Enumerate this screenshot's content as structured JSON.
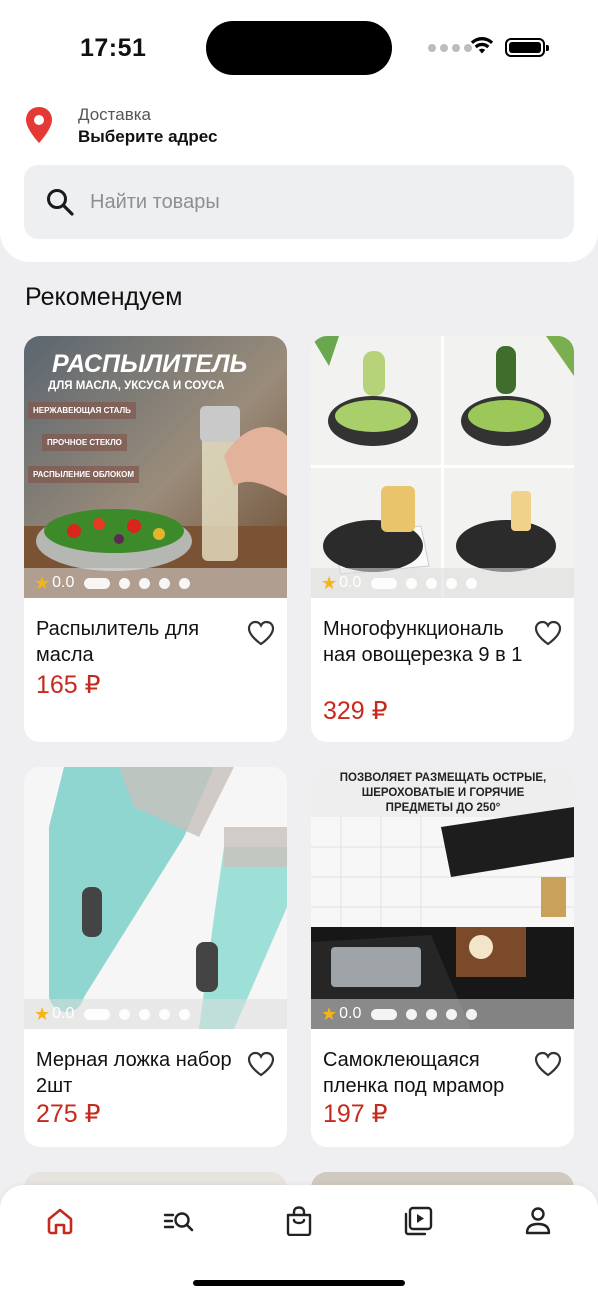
{
  "status_bar": {
    "time": "17:51"
  },
  "header": {
    "delivery_label": "Доставка",
    "delivery_address": "Выберите адрес",
    "search_placeholder": "Найти товары"
  },
  "section": {
    "title": "Рекомендуем"
  },
  "products": [
    {
      "title": "Распылитель для масла",
      "price": "165 ₽",
      "rating": "0.0",
      "image_text": {
        "headline": "РАСПЫЛИТЕЛЬ",
        "subline": "ДЛЯ МАСЛА, УКСУСА И СОУСА",
        "features": [
          "НЕРЖАВЕЮЩАЯ СТАЛЬ",
          "ПРОЧНОЕ СТЕКЛО",
          "РАСПЫЛЕНИЕ ОБЛОКОМ"
        ]
      }
    },
    {
      "title": "Многофункциональ ная овощерезка 9 в 1",
      "price": "329 ₽",
      "rating": "0.0"
    },
    {
      "title": "Мерная ложка набор 2шт",
      "price": "275 ₽",
      "rating": "0.0"
    },
    {
      "title": "Самоклеющаяся пленка под мрамор",
      "price": "197 ₽",
      "rating": "0.0",
      "image_text": {
        "caption": "ПОЗВОЛЯЕТ РАЗМЕЩАТЬ ОСТРЫЕ, ШЕРОХОВАТЫЕ И ГОРЯЧИЕ ПРЕДМЕТЫ ДО 250°"
      }
    }
  ],
  "tab_bar": {
    "items": [
      "home-icon",
      "catalog-search-icon",
      "cart-bag-icon",
      "video-icon",
      "profile-icon"
    ],
    "active_index": 0
  },
  "colors": {
    "accent": "#c62a1e",
    "background": "#efeff1",
    "rating_star": "#f5b516"
  }
}
